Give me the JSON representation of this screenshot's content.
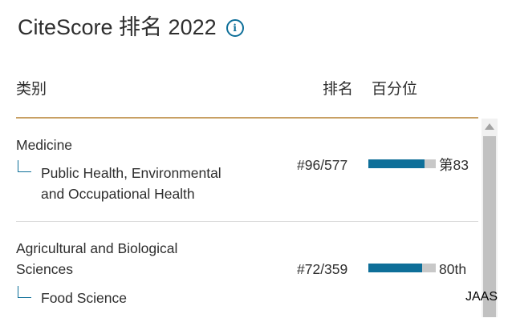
{
  "header": {
    "title": "CiteScore 排名 2022",
    "info_icon": "info-icon",
    "info_glyph": "i"
  },
  "columns": {
    "category": "类别",
    "rank": "排名",
    "percentile": "百分位"
  },
  "rows": [
    {
      "category": "Medicine",
      "subcategory_line1": "Public Health, Environmental",
      "subcategory_line2": "and Occupational Health",
      "rank": "#96/577",
      "percentile_label": "第83",
      "percentile_value": 0.83
    },
    {
      "category_line1": "Agricultural and Biological",
      "category_line2": "Sciences",
      "subcategory": "Food Science",
      "rank": "#72/359",
      "percentile_label": "80th",
      "percentile_value": 0.8
    }
  ],
  "colors": {
    "accent": "#0e6f99",
    "bar_track": "#c8c8c8",
    "header_rule": "#c8a064",
    "text": "#2e2e2e"
  },
  "watermark": "JAAS"
}
